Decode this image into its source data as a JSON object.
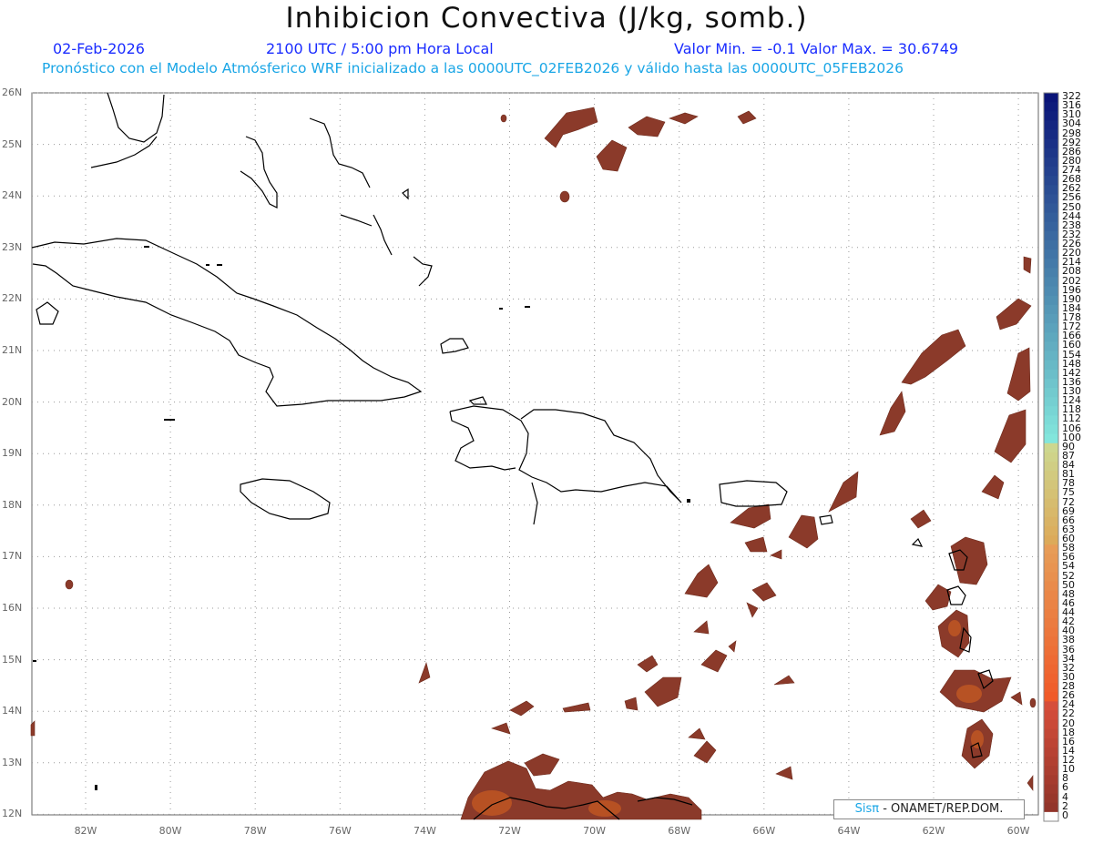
{
  "header": {
    "title": "Inhibicion Convectiva (J/kg, somb.)",
    "date": "02-Feb-2026",
    "time": "2100 UTC / 5:00 pm Hora Local",
    "range": "Valor Min. = -0.1  Valor Max. = 30.6749",
    "subtitle": "Pronóstico con el Modelo Atmósferico WRF inicializado a las 0000UTC_02FEB2026 y válido hasta las  0000UTC_05FEB2026"
  },
  "axes": {
    "lat_labels": [
      "26N",
      "25N",
      "24N",
      "23N",
      "22N",
      "21N",
      "20N",
      "19N",
      "18N",
      "17N",
      "16N",
      "15N",
      "14N",
      "13N",
      "12N"
    ],
    "lon_labels": [
      "82W",
      "80W",
      "78W",
      "76W",
      "74W",
      "72W",
      "70W",
      "68W",
      "66W",
      "64W",
      "62W",
      "60W"
    ]
  },
  "colorbar": {
    "labels": [
      "322",
      "316",
      "310",
      "304",
      "298",
      "292",
      "286",
      "280",
      "274",
      "268",
      "262",
      "256",
      "250",
      "244",
      "238",
      "232",
      "226",
      "220",
      "214",
      "208",
      "202",
      "196",
      "190",
      "184",
      "178",
      "172",
      "166",
      "160",
      "154",
      "148",
      "142",
      "136",
      "130",
      "124",
      "118",
      "112",
      "106",
      "100",
      "90",
      "87",
      "84",
      "81",
      "78",
      "75",
      "72",
      "69",
      "66",
      "63",
      "60",
      "58",
      "56",
      "54",
      "52",
      "50",
      "48",
      "46",
      "44",
      "42",
      "40",
      "38",
      "36",
      "34",
      "32",
      "30",
      "28",
      "26",
      "24",
      "22",
      "20",
      "18",
      "16",
      "14",
      "12",
      "10",
      "8",
      "6",
      "4",
      "2",
      "0"
    ]
  },
  "credit": {
    "brand": "Sisπ",
    "text": " - ONAMET/REP.DOM."
  },
  "colors": {
    "field": "#8b3a2a",
    "field_high": "#c8581e",
    "coast": "#000000",
    "grid": "#9a9a9a"
  }
}
